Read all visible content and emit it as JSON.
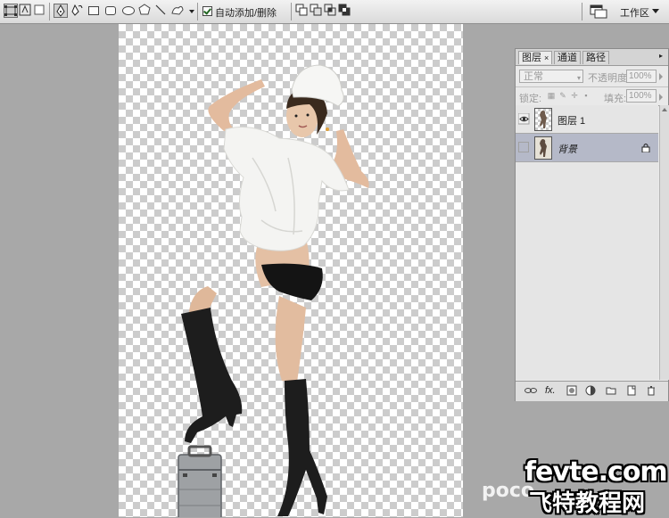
{
  "options_bar": {
    "auto_add_delete_label": "自动添加/删除",
    "auto_add_delete_checked": true,
    "workspace_label": "工作区"
  },
  "icons": {
    "tools": [
      "shape-layers-icon",
      "paths-icon",
      "fill-pixels-icon",
      "pen-icon",
      "freeform-pen-icon",
      "rectangle-icon",
      "rounded-rectangle-icon",
      "ellipse-icon",
      "polygon-icon",
      "line-icon",
      "custom-shape-icon"
    ],
    "path_ops": [
      "add-to-area-icon",
      "subtract-from-area-icon",
      "intersect-area-icon",
      "exclude-overlap-icon"
    ],
    "lock": [
      "lock-transparent-icon",
      "lock-image-icon",
      "lock-position-icon",
      "lock-all-icon"
    ],
    "panel_bottom": [
      "link-layers-icon",
      "layer-style-icon",
      "layer-mask-icon",
      "adjustment-layer-icon",
      "group-icon",
      "new-layer-icon",
      "delete-layer-icon"
    ]
  },
  "layers_panel": {
    "tabs": [
      {
        "label": "图层",
        "close": "×",
        "active": true
      },
      {
        "label": "通道",
        "active": false
      },
      {
        "label": "路径",
        "active": false
      }
    ],
    "blend_mode": "正常",
    "opacity_label": "不透明度:",
    "opacity_value": "100%",
    "lock_label": "锁定:",
    "fill_label": "填充:",
    "fill_value": "100%",
    "layers": [
      {
        "name": "图层 1",
        "visible": true,
        "selected": false,
        "locked": false
      },
      {
        "name": "背景",
        "visible": false,
        "selected": true,
        "locked": true
      }
    ]
  },
  "watermark": {
    "domain": "fevte.com",
    "site": "飞特教程网",
    "poco": "poco"
  },
  "colors": {
    "workspace": "#a8a8a8",
    "panel": "#e9e9e9",
    "selected_layer": "#b5b9c8"
  }
}
